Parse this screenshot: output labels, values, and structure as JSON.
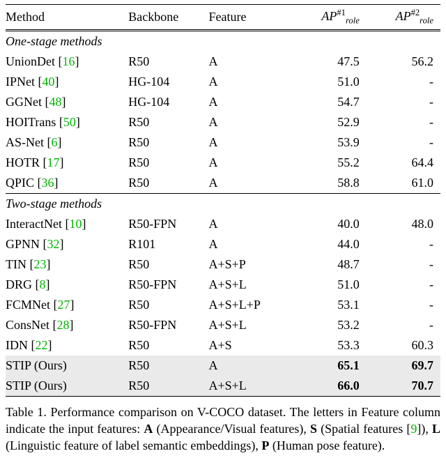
{
  "header": {
    "method": "Method",
    "backbone": "Backbone",
    "feature": "Feature",
    "ap1_html": "<span class='apcol'>AP</span><span class='sup'>#1</span><span class='sub'>role</span>",
    "ap2_html": "<span class='apcol'>AP</span><span class='sup'>#2</span><span class='sub'>role</span>"
  },
  "sections": [
    {
      "label": "One-stage methods",
      "rows": [
        {
          "name": "UnionDet",
          "cite": "16",
          "backbone": "R50",
          "feature": "A",
          "ap1": "47.5",
          "ap2": "56.2"
        },
        {
          "name": "IPNet",
          "cite": "40",
          "backbone": "HG-104",
          "feature": "A",
          "ap1": "51.0",
          "ap2": "-"
        },
        {
          "name": "GGNet",
          "cite": "48",
          "backbone": "HG-104",
          "feature": "A",
          "ap1": "54.7",
          "ap2": "-"
        },
        {
          "name": "HOITrans",
          "cite": "50",
          "backbone": "R50",
          "feature": "A",
          "ap1": "52.9",
          "ap2": "-"
        },
        {
          "name": "AS-Net",
          "cite": "6",
          "backbone": "R50",
          "feature": "A",
          "ap1": "53.9",
          "ap2": "-"
        },
        {
          "name": "HOTR",
          "cite": "17",
          "backbone": "R50",
          "feature": "A",
          "ap1": "55.2",
          "ap2": "64.4"
        },
        {
          "name": "QPIC",
          "cite": "36",
          "backbone": "R50",
          "feature": "A",
          "ap1": "58.8",
          "ap2": "61.0"
        }
      ]
    },
    {
      "label": "Two-stage methods",
      "rows": [
        {
          "name": "InteractNet",
          "cite": "10",
          "backbone": "R50-FPN",
          "feature": "A",
          "ap1": "40.0",
          "ap2": "48.0"
        },
        {
          "name": "GPNN",
          "cite": "32",
          "backbone": "R101",
          "feature": "A",
          "ap1": "44.0",
          "ap2": "-"
        },
        {
          "name": "TIN",
          "cite": "23",
          "backbone": "R50",
          "feature": "A+S+P",
          "ap1": "48.7",
          "ap2": "-"
        },
        {
          "name": "DRG",
          "cite": "8",
          "backbone": "R50-FPN",
          "feature": "A+S+L",
          "ap1": "51.0",
          "ap2": "-"
        },
        {
          "name": "FCMNet",
          "cite": "27",
          "backbone": "R50",
          "feature": "A+S+L+P",
          "ap1": "53.1",
          "ap2": "-"
        },
        {
          "name": "ConsNet",
          "cite": "28",
          "backbone": "R50-FPN",
          "feature": "A+S+L",
          "ap1": "53.2",
          "ap2": "-"
        },
        {
          "name": "IDN",
          "cite": "22",
          "backbone": "R50",
          "feature": "A+S",
          "ap1": "53.3",
          "ap2": "60.3"
        },
        {
          "name": "STIP (Ours)",
          "cite": "",
          "backbone": "R50",
          "feature": "A",
          "ap1": "65.1",
          "ap2": "69.7",
          "highlight": true,
          "bold": true
        },
        {
          "name": "STIP (Ours)",
          "cite": "",
          "backbone": "R50",
          "feature": "A+S+L",
          "ap1": "66.0",
          "ap2": "70.7",
          "highlight": true,
          "bold": true
        }
      ]
    }
  ],
  "caption": {
    "prefix": "Table 1. Performance comparison on V-COCO dataset. The letters in Feature column indicate the input features: ",
    "a_b": "A",
    "a_t": " (Appearance/Visual features), ",
    "s_b": "S",
    "s_t": " (Spatial features [",
    "s_cite": "9",
    "s_t2": "]), ",
    "l_b": "L",
    "l_t": " (Linguistic feature of label semantic embeddings), ",
    "p_b": "P",
    "p_t": " (Human pose feature)."
  },
  "chart_data": {
    "type": "table",
    "title": "Performance comparison on V-COCO dataset",
    "columns": [
      "Method",
      "Backbone",
      "Feature",
      "AP_role^#1",
      "AP_role^#2"
    ],
    "groups": [
      {
        "name": "One-stage methods",
        "rows": [
          [
            "UnionDet [16]",
            "R50",
            "A",
            47.5,
            56.2
          ],
          [
            "IPNet [40]",
            "HG-104",
            "A",
            51.0,
            null
          ],
          [
            "GGNet [48]",
            "HG-104",
            "A",
            54.7,
            null
          ],
          [
            "HOITrans [50]",
            "R50",
            "A",
            52.9,
            null
          ],
          [
            "AS-Net [6]",
            "R50",
            "A",
            53.9,
            null
          ],
          [
            "HOTR [17]",
            "R50",
            "A",
            55.2,
            64.4
          ],
          [
            "QPIC [36]",
            "R50",
            "A",
            58.8,
            61.0
          ]
        ]
      },
      {
        "name": "Two-stage methods",
        "rows": [
          [
            "InteractNet [10]",
            "R50-FPN",
            "A",
            40.0,
            48.0
          ],
          [
            "GPNN [32]",
            "R101",
            "A",
            44.0,
            null
          ],
          [
            "TIN [23]",
            "R50",
            "A+S+P",
            48.7,
            null
          ],
          [
            "DRG [8]",
            "R50-FPN",
            "A+S+L",
            51.0,
            null
          ],
          [
            "FCMNet [27]",
            "R50",
            "A+S+L+P",
            53.1,
            null
          ],
          [
            "ConsNet [28]",
            "R50-FPN",
            "A+S+L",
            53.2,
            null
          ],
          [
            "IDN [22]",
            "R50",
            "A+S",
            53.3,
            60.3
          ],
          [
            "STIP (Ours)",
            "R50",
            "A",
            65.1,
            69.7
          ],
          [
            "STIP (Ours)",
            "R50",
            "A+S+L",
            66.0,
            70.7
          ]
        ]
      }
    ]
  }
}
